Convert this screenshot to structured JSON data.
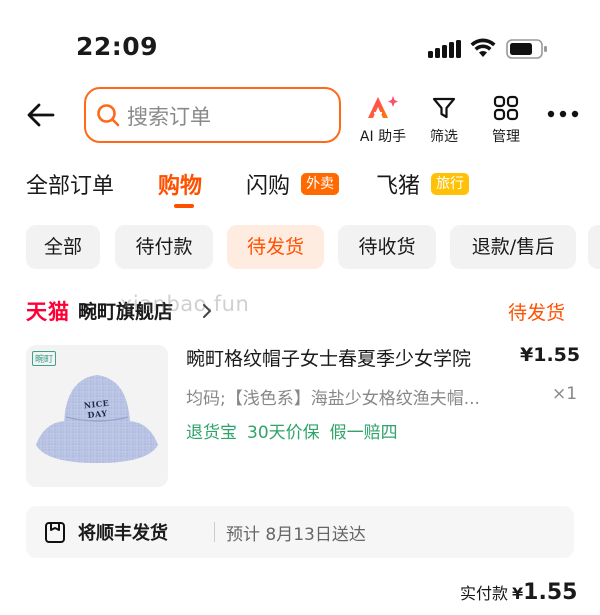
{
  "status_bar": {
    "time": "22:09"
  },
  "search": {
    "placeholder": "搜索订单"
  },
  "header_actions": {
    "ai_label": "AI 助手",
    "filter_label": "筛选",
    "manage_label": "管理"
  },
  "tabs": [
    {
      "label": "全部订单"
    },
    {
      "label": "购物"
    },
    {
      "label": "闪购",
      "badge": "外卖"
    },
    {
      "label": "飞猪",
      "badge": "旅行"
    }
  ],
  "chips": [
    {
      "label": "全部"
    },
    {
      "label": "待付款"
    },
    {
      "label": "待发货"
    },
    {
      "label": "待收货"
    },
    {
      "label": "退款/售后"
    }
  ],
  "order": {
    "platform": "天猫",
    "shop_name": "畹町旗舰店",
    "watermark": "xianbao.fun",
    "status": "待发货",
    "product": {
      "brand_mark": "畹町",
      "hat_text": "NICE DAY",
      "title": "畹町格纹帽子女士春夏季少女学院",
      "price": "¥1.55",
      "sku": "均码;【浅色系】海盐少女格纹渔夫帽...",
      "qty": "×1",
      "guarantees": [
        "退货宝",
        "30天价保",
        "假一赔四"
      ]
    },
    "shipping": {
      "title": "将顺丰发货",
      "estimate": "预计 8月13日送达"
    },
    "total": {
      "label": "实付款",
      "currency": "¥",
      "amount": "1.55"
    }
  },
  "colors": {
    "accent": "#ff5000",
    "search_border": "#ff6a1a",
    "tmall_red": "#ff0036",
    "guarantee_green": "#2fa36a",
    "chip_bg": "#f2f2f2",
    "chip_active_bg": "#ffece0"
  }
}
